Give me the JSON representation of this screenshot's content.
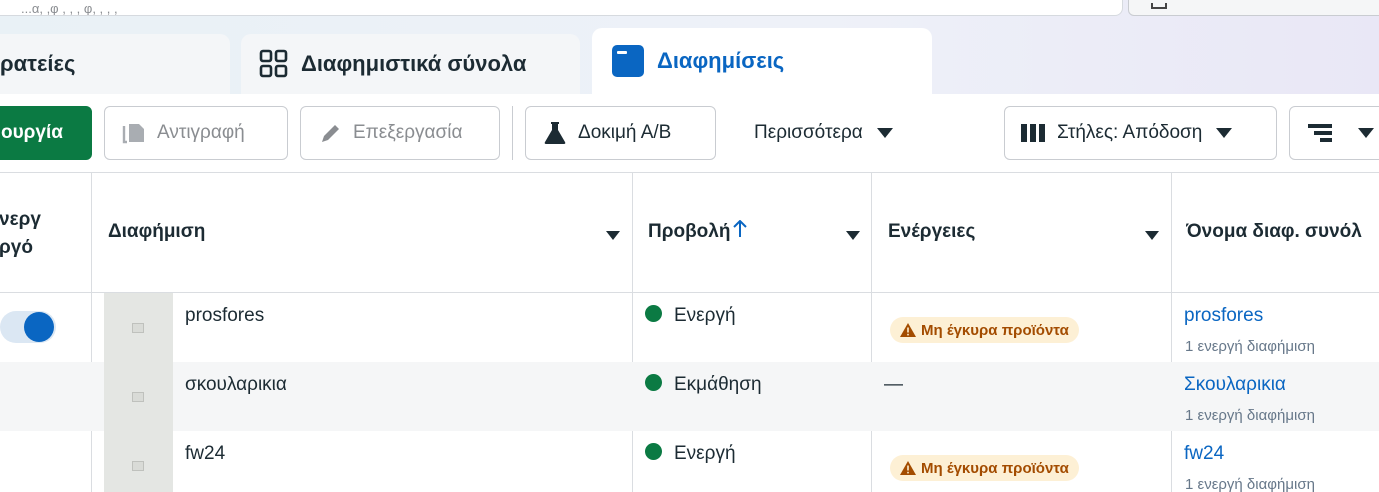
{
  "top": {
    "search_text": "...α, ,φ , , , φ, , , ,"
  },
  "tabs": [
    {
      "label": "ρατείες"
    },
    {
      "label": "Διαφημιστικά σύνολα"
    },
    {
      "label": "Διαφημίσεις"
    }
  ],
  "toolbar": {
    "create_label": "ουργία",
    "duplicate_label": "Αντιγραφή",
    "edit_label": "Επεξεργασία",
    "ab_test_label": "Δοκιμή Α/Β",
    "more_label": "Περισσότερα",
    "columns_label": "Στήλες: Απόδοση"
  },
  "table": {
    "headers": {
      "offon_line1": "ενεργ",
      "offon_line2": "εργό",
      "ad": "Διαφήμιση",
      "delivery": "Προβολή",
      "actions": "Ενέργειες",
      "adset_name": "Όνομα διαφ. συνόλ"
    },
    "rows": [
      {
        "name": "prosfores",
        "delivery": "Ενεργή",
        "actions": "Μη έγκυρα προϊόντα",
        "adset": "prosfores",
        "adset_sub": "1 ενεργή διαφήμιση"
      },
      {
        "name": "σκουλαρικια",
        "delivery": "Εκμάθηση",
        "actions": "—",
        "adset": "Σκουλαρικια",
        "adset_sub": "1 ενεργή διαφήμιση"
      },
      {
        "name": "fw24",
        "delivery": "Ενεργή",
        "actions": "Μη έγκυρα προϊόντα",
        "adset": "fw24",
        "adset_sub": "1 ενεργή διαφήμιση"
      }
    ]
  },
  "colors": {
    "primary_green": "#0b7a43",
    "link_blue": "#0a66c2",
    "warning_bg": "#fdf0d5",
    "warning_text": "#a34c00"
  }
}
